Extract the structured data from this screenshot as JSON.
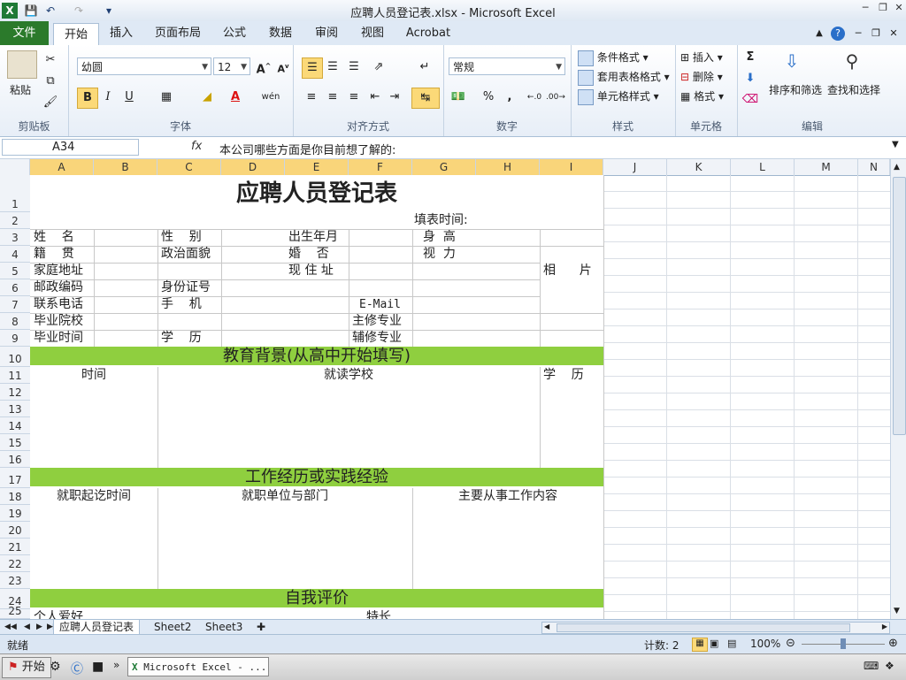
{
  "window": {
    "title": "应聘人员登记表.xlsx - Microsoft Excel"
  },
  "ribbon": {
    "tabs": [
      "文件",
      "开始",
      "插入",
      "页面布局",
      "公式",
      "数据",
      "审阅",
      "视图",
      "Acrobat"
    ],
    "clipboard": {
      "paste": "粘贴",
      "label": "剪贴板"
    },
    "font": {
      "name": "幼圆",
      "size": "12",
      "label": "字体",
      "bold": "B",
      "italic": "I",
      "underline": "U"
    },
    "alignment": {
      "label": "对齐方式"
    },
    "number": {
      "format": "常规",
      "label": "数字",
      "percent": "%",
      "comma": ","
    },
    "styles": {
      "conditional": "条件格式",
      "table": "套用表格格式",
      "cell": "单元格样式",
      "label": "样式"
    },
    "cells": {
      "insert": "插入",
      "delete": "删除",
      "format": "格式",
      "label": "单元格"
    },
    "editing": {
      "sort": "排序和筛选",
      "find": "查找和选择",
      "label": "编辑"
    }
  },
  "formula_bar": {
    "name_box": "A34",
    "fx": "fx",
    "content": "本公司哪些方面是你目前想了解的:"
  },
  "columns": [
    "A",
    "B",
    "C",
    "D",
    "E",
    "F",
    "G",
    "H",
    "I",
    "J",
    "K",
    "L",
    "M",
    "N"
  ],
  "rows": [
    "1",
    "2",
    "3",
    "4",
    "5",
    "6",
    "7",
    "8",
    "9",
    "10",
    "11",
    "12",
    "13",
    "14",
    "15",
    "16",
    "17",
    "18",
    "19",
    "20",
    "21",
    "22",
    "23",
    "24",
    "25"
  ],
  "sheet": {
    "title": "应聘人员登记表",
    "fill_time": "填表时间:",
    "name": "姓    名",
    "gender": "性    别",
    "birth": "出生年月",
    "height": "身  高",
    "native": "籍    贯",
    "politics": "政治面貌",
    "marriage": "婚    否",
    "vision": "视  力",
    "address": "家庭地址",
    "current_address": "现 住 址",
    "photo": "相      片",
    "postcode": "邮政编码",
    "id_number": "身份证号",
    "phone": "联系电话",
    "mobile": "手    机",
    "email": "E-Mail",
    "school": "毕业院校",
    "major": "主修专业",
    "grad_time": "毕业时间",
    "degree": "学    历",
    "minor": "辅修专业",
    "edu_header": "教育背景(从高中开始填写)",
    "edu_time": "时间",
    "edu_school": "就读学校",
    "edu_degree": "学    历",
    "work_header": "工作经历或实践经验",
    "work_time": "就职起讫时间",
    "work_unit": "就职单位与部门",
    "work_content": "主要从事工作内容",
    "self_header": "自我评价",
    "hobby": "个人爱好",
    "specialty": "特长"
  },
  "sheet_tabs": [
    "应聘人员登记表",
    "Sheet2",
    "Sheet3"
  ],
  "status": {
    "ready": "就绪",
    "count": "计数: 2",
    "zoom": "100%"
  },
  "taskbar": {
    "start": "开始",
    "task": "Microsoft Excel - ..."
  }
}
